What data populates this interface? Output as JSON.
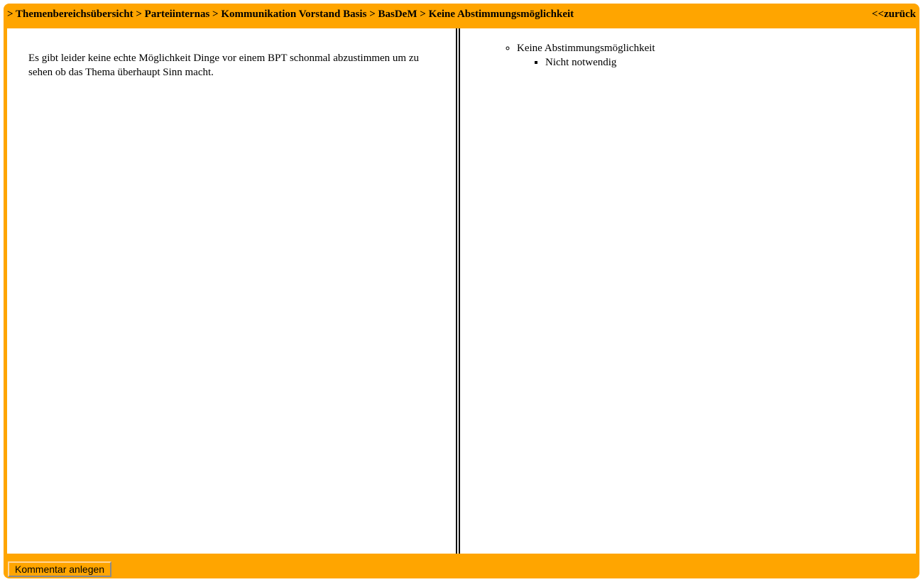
{
  "colors": {
    "frame": "#ffa500",
    "content_background": "#ffffff",
    "text": "#000000"
  },
  "breadcrumb": {
    "items": [
      {
        "prefix": "> ",
        "label": "Themenbereichsübersicht"
      },
      {
        "prefix": " > ",
        "label": "Parteiinternas"
      },
      {
        "prefix": " > ",
        "label": "Kommunikation Vorstand Basis"
      },
      {
        "prefix": " > ",
        "label": "BasDeM"
      },
      {
        "prefix": " > ",
        "label": "Keine Abstimmungsmöglichkeit"
      }
    ]
  },
  "header": {
    "back_label": "<<zurück"
  },
  "left_pane": {
    "text": "Es gibt leider keine echte Möglichkeit Dinge vor einem BPT schonmal abzustimmen um zu sehen ob das Thema überhaupt Sinn macht."
  },
  "right_pane": {
    "tree": {
      "label": "Keine Abstimmungsmöglichkeit",
      "children": [
        {
          "label": "Nicht notwendig"
        }
      ]
    }
  },
  "footer": {
    "comment_button_label": "Kommentar anlegen"
  }
}
